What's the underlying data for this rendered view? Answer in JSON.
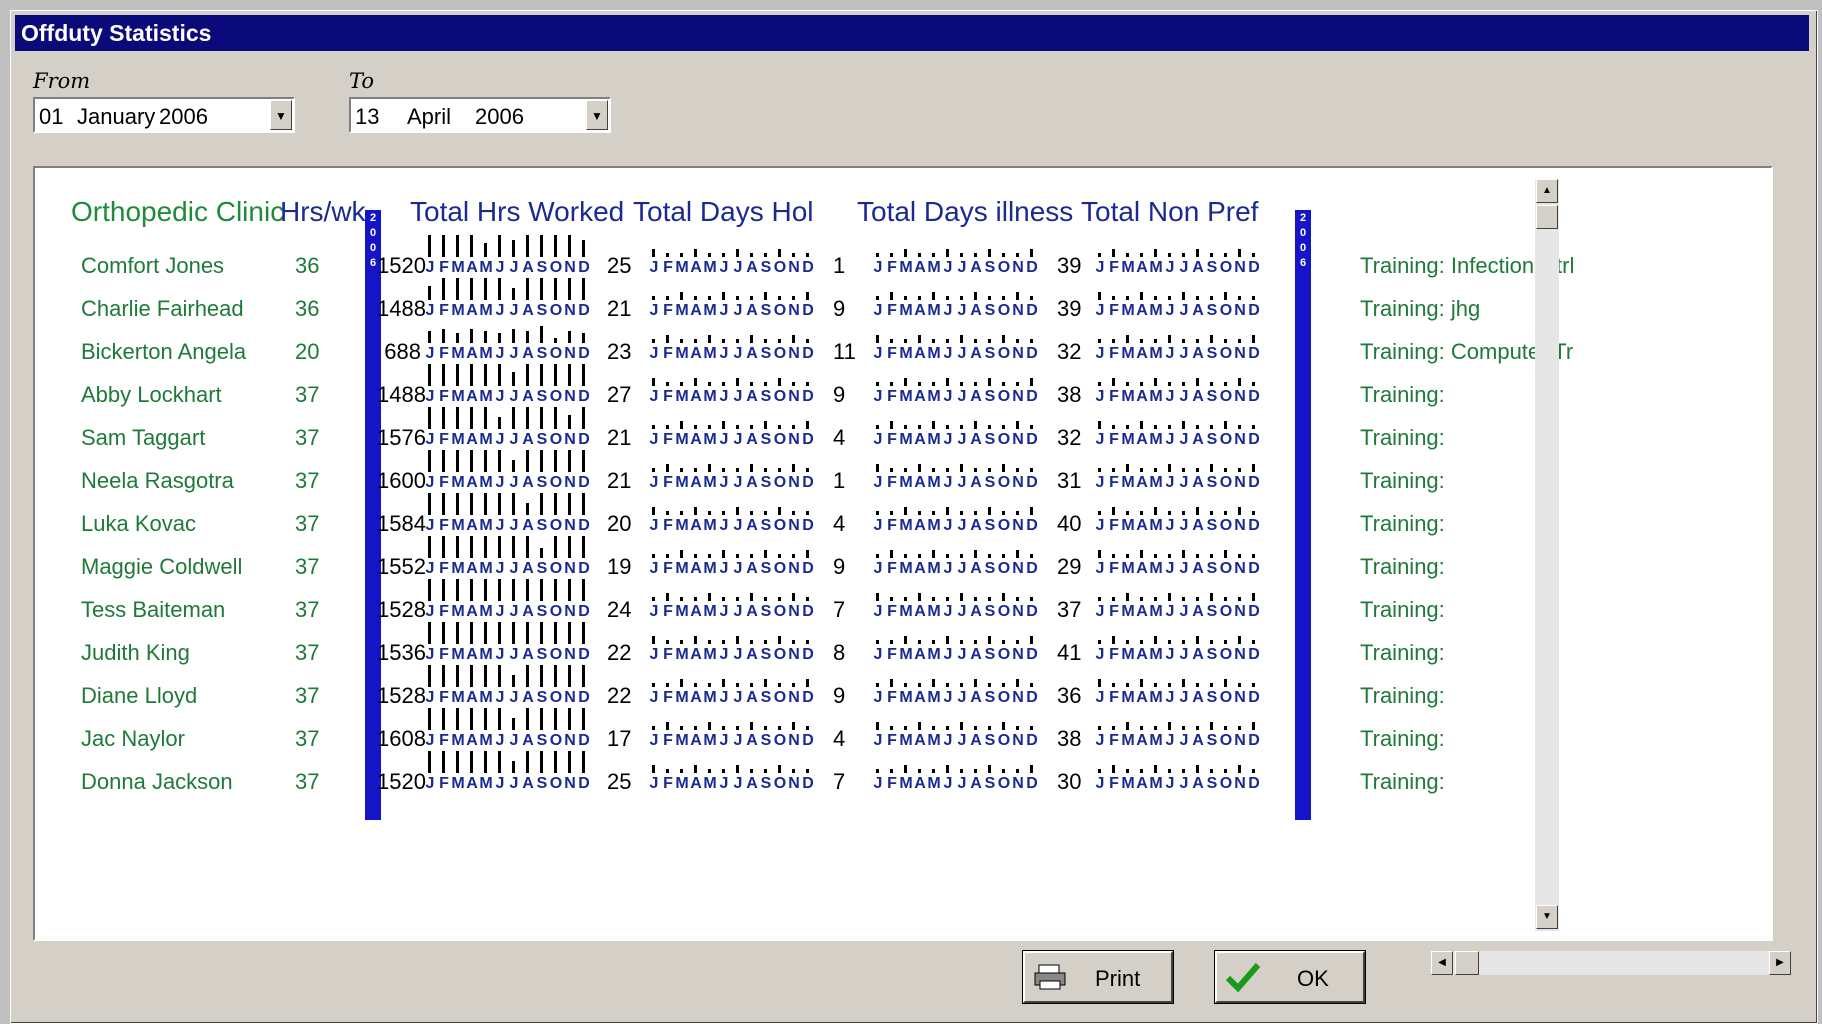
{
  "window": {
    "title": "Offduty Statistics"
  },
  "from": {
    "label": "From",
    "day": "01",
    "month": "January",
    "year": "2006"
  },
  "to": {
    "label": "To",
    "day": "13",
    "month": "April",
    "year": "2006"
  },
  "headers": {
    "clinic": "Orthopedic Clinic",
    "hrs": "Hrs/wk",
    "total_hrs": "Total Hrs Worked",
    "days_hol": "Total Days Hol",
    "days_illness": "Total Days illness",
    "non_pref": "Total Non Pref"
  },
  "year_marker": [
    "2",
    "0",
    "0",
    "6"
  ],
  "month_letters": [
    "J",
    "F",
    "M",
    "A",
    "M",
    "J",
    "J",
    "A",
    "S",
    "O",
    "N",
    "D"
  ],
  "staff": [
    {
      "name": "Comfort Jones",
      "hrs": "36",
      "total_hrs": "1520",
      "hol": "25",
      "ill": "1",
      "nonpref": "39",
      "training": "Training: Infection Ctrl",
      "bars": [
        0.9,
        0.9,
        0.9,
        0.9,
        0.6,
        0.9,
        0.7,
        0.9,
        0.9,
        0.9,
        0.9,
        0.7
      ]
    },
    {
      "name": "Charlie Fairhead",
      "hrs": "36",
      "total_hrs": "1488",
      "hol": "21",
      "ill": "9",
      "nonpref": "39",
      "training": "Training: jhg",
      "bars": [
        0.6,
        0.9,
        0.9,
        0.9,
        0.9,
        0.9,
        0.5,
        0.9,
        0.9,
        0.9,
        0.9,
        0.9
      ]
    },
    {
      "name": "Bickerton Angela",
      "hrs": "20",
      "total_hrs": "688",
      "hol": "23",
      "ill": "11",
      "nonpref": "32",
      "training": "Training: Computer Tr",
      "bars": [
        0.5,
        0.6,
        0.4,
        0.6,
        0.5,
        0.4,
        0.6,
        0.5,
        0.7,
        0.2,
        0.5,
        0.4
      ]
    },
    {
      "name": "Abby Lockhart",
      "hrs": "37",
      "total_hrs": "1488",
      "hol": "27",
      "ill": "9",
      "nonpref": "38",
      "training": "Training:",
      "bars": [
        0.9,
        0.9,
        0.9,
        0.9,
        0.9,
        0.9,
        0.6,
        0.9,
        0.9,
        0.9,
        0.9,
        0.9
      ]
    },
    {
      "name": "Sam Taggart",
      "hrs": "37",
      "total_hrs": "1576",
      "hol": "21",
      "ill": "4",
      "nonpref": "32",
      "training": "Training:",
      "bars": [
        0.9,
        0.9,
        0.9,
        0.9,
        0.9,
        0.5,
        0.9,
        0.9,
        0.9,
        0.9,
        0.6,
        0.9
      ]
    },
    {
      "name": "Neela Rasgotra",
      "hrs": "37",
      "total_hrs": "1600",
      "hol": "21",
      "ill": "1",
      "nonpref": "31",
      "training": "Training:",
      "bars": [
        0.9,
        0.9,
        0.9,
        0.9,
        0.9,
        0.9,
        0.5,
        0.9,
        0.9,
        0.9,
        0.9,
        0.9
      ]
    },
    {
      "name": "Luka Kovac",
      "hrs": "37",
      "total_hrs": "1584",
      "hol": "20",
      "ill": "4",
      "nonpref": "40",
      "training": "Training:",
      "bars": [
        0.9,
        0.9,
        0.9,
        0.9,
        0.9,
        0.9,
        0.9,
        0.5,
        0.9,
        0.9,
        0.9,
        0.9
      ]
    },
    {
      "name": "Maggie Coldwell",
      "hrs": "37",
      "total_hrs": "1552",
      "hol": "19",
      "ill": "9",
      "nonpref": "29",
      "training": "Training:",
      "bars": [
        0.9,
        0.9,
        0.9,
        0.9,
        0.9,
        0.9,
        0.9,
        0.9,
        0.4,
        0.9,
        0.9,
        0.9
      ]
    },
    {
      "name": "Tess Baiteman",
      "hrs": "37",
      "total_hrs": "1528",
      "hol": "24",
      "ill": "7",
      "nonpref": "37",
      "training": "Training:",
      "bars": [
        0.9,
        0.9,
        0.9,
        0.9,
        0.9,
        0.9,
        0.9,
        0.9,
        0.9,
        0.9,
        0.9,
        0.9
      ]
    },
    {
      "name": "Judith King",
      "hrs": "37",
      "total_hrs": "1536",
      "hol": "22",
      "ill": "8",
      "nonpref": "41",
      "training": "Training:",
      "bars": [
        0.9,
        0.9,
        0.9,
        0.9,
        0.9,
        0.9,
        0.9,
        0.9,
        0.9,
        0.9,
        0.9,
        0.9
      ]
    },
    {
      "name": "Diane Lloyd",
      "hrs": "37",
      "total_hrs": "1528",
      "hol": "22",
      "ill": "9",
      "nonpref": "36",
      "training": "Training:",
      "bars": [
        0.9,
        0.9,
        0.9,
        0.9,
        0.9,
        0.9,
        0.5,
        0.9,
        0.9,
        0.9,
        0.9,
        0.9
      ]
    },
    {
      "name": "Jac Naylor",
      "hrs": "37",
      "total_hrs": "1608",
      "hol": "17",
      "ill": "4",
      "nonpref": "38",
      "training": "Training:",
      "bars": [
        0.9,
        0.9,
        0.9,
        0.9,
        0.9,
        0.9,
        0.5,
        0.9,
        0.9,
        0.9,
        0.9,
        0.9
      ]
    },
    {
      "name": "Donna Jackson",
      "hrs": "37",
      "total_hrs": "1520",
      "hol": "25",
      "ill": "7",
      "nonpref": "30",
      "training": "Training:",
      "bars": [
        0.9,
        0.9,
        0.9,
        0.9,
        0.9,
        0.9,
        0.5,
        0.9,
        0.9,
        0.9,
        0.9,
        0.9
      ]
    }
  ],
  "buttons": {
    "print": "Print",
    "ok": "OK"
  },
  "icons": {
    "print": "printer-icon",
    "ok": "checkmark-icon"
  }
}
